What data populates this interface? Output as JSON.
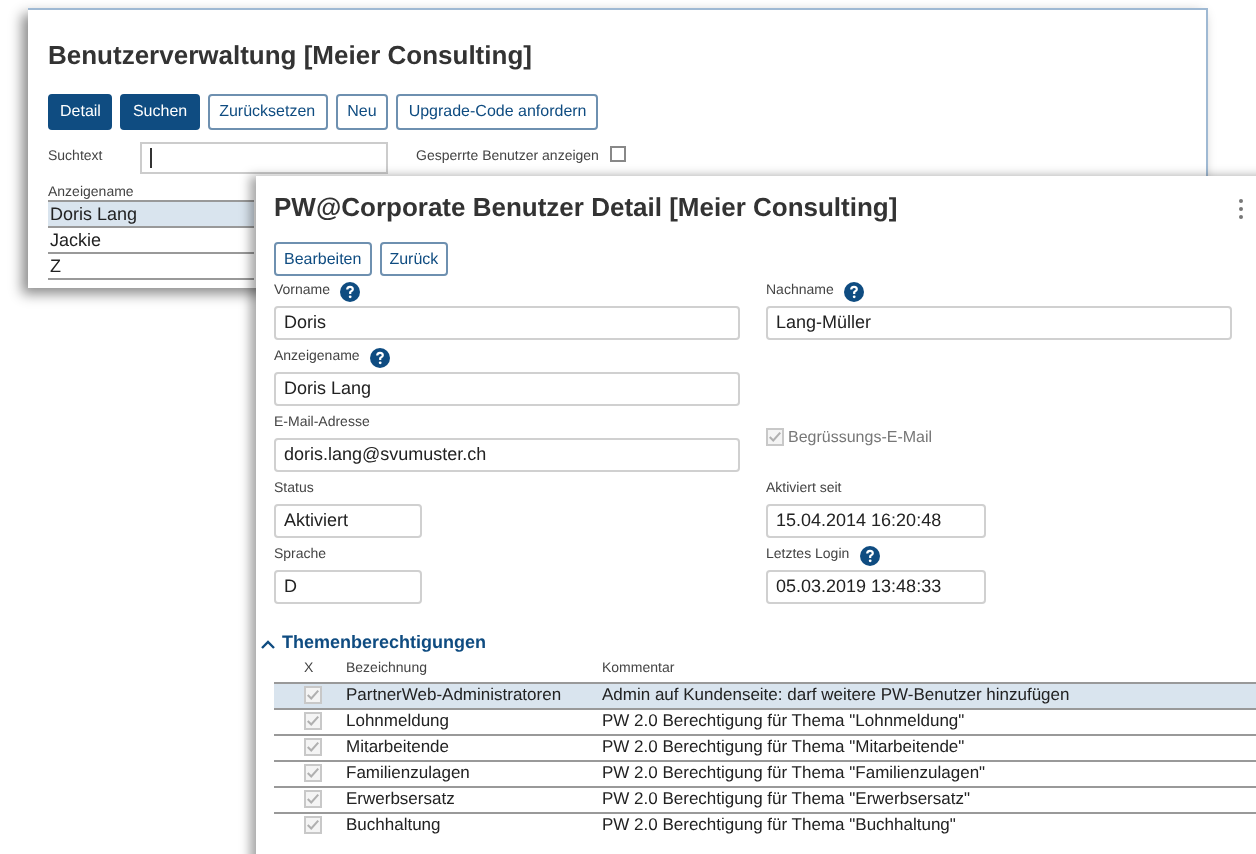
{
  "back_window": {
    "title": "Benutzerverwaltung [Meier Consulting]",
    "buttons": [
      {
        "label": "Detail",
        "primary": true
      },
      {
        "label": "Suchen",
        "primary": true
      },
      {
        "label": "Zurücksetzen",
        "primary": false
      },
      {
        "label": "Neu",
        "primary": false
      },
      {
        "label": "Upgrade-Code anfordern",
        "primary": false
      }
    ],
    "search": {
      "label": "Suchtext"
    },
    "locked_filter": {
      "label": "Gesperrte Benutzer anzeigen",
      "checked": false
    },
    "table": {
      "columns": [
        "Anzeigename"
      ],
      "rows": [
        {
          "name": "Doris Lang",
          "selected": true
        },
        {
          "name": "Jackie",
          "selected": false
        },
        {
          "name": "Z",
          "selected": false
        }
      ]
    }
  },
  "detail_window": {
    "title": "PW@Corporate Benutzer Detail [Meier Consulting]",
    "buttons": [
      "Bearbeiten",
      "Zurück"
    ],
    "fields": [
      {
        "label": "Vorname",
        "value": "Doris",
        "help": true,
        "kind": "wide"
      },
      {
        "label": "Nachname",
        "value": "Lang-Müller",
        "help": true,
        "kind": "wide"
      },
      {
        "label": "Anzeigename",
        "value": "Doris Lang",
        "help": true,
        "kind": "wide"
      },
      {
        "kind": "empty"
      },
      {
        "label": "E-Mail-Adresse",
        "value": "doris.lang@svumuster.ch",
        "help": false,
        "kind": "wide"
      },
      {
        "label": "Begrüssungs-E-Mail",
        "checked": true,
        "kind": "checkbox"
      },
      {
        "label": "Status",
        "value": "Aktiviert",
        "help": false,
        "kind": "short"
      },
      {
        "label": "Aktiviert seit",
        "value": "15.04.2014 16:20:48",
        "help": false,
        "kind": "medium"
      },
      {
        "label": "Sprache",
        "value": "D",
        "help": false,
        "kind": "short"
      },
      {
        "label": "Letztes Login",
        "value": "05.03.2019 13:48:33",
        "help": true,
        "kind": "medium"
      }
    ],
    "section": {
      "title": "Themenberechtigungen",
      "expanded": true,
      "columns": [
        "X",
        "Bezeichnung",
        "Kommentar"
      ],
      "rows": [
        {
          "checked": true,
          "name": "PartnerWeb-Administratoren",
          "comment": "Admin auf Kundenseite: darf weitere PW-Benutzer hinzufügen",
          "selected": true
        },
        {
          "checked": true,
          "name": "Lohnmeldung",
          "comment": "PW 2.0 Berechtigung für Thema \"Lohnmeldung\"",
          "selected": false
        },
        {
          "checked": true,
          "name": "Mitarbeitende",
          "comment": "PW 2.0 Berechtigung für Thema \"Mitarbeitende\"",
          "selected": false
        },
        {
          "checked": true,
          "name": "Familienzulagen",
          "comment": "PW 2.0 Berechtigung für Thema \"Familienzulagen\"",
          "selected": false
        },
        {
          "checked": true,
          "name": "Erwerbsersatz",
          "comment": "PW 2.0 Berechtigung für Thema \"Erwerbsersatz\"",
          "selected": false
        },
        {
          "checked": true,
          "name": "Buchhaltung",
          "comment": "PW 2.0 Berechtigung für Thema \"Buchhaltung\"",
          "selected": false
        }
      ]
    }
  }
}
